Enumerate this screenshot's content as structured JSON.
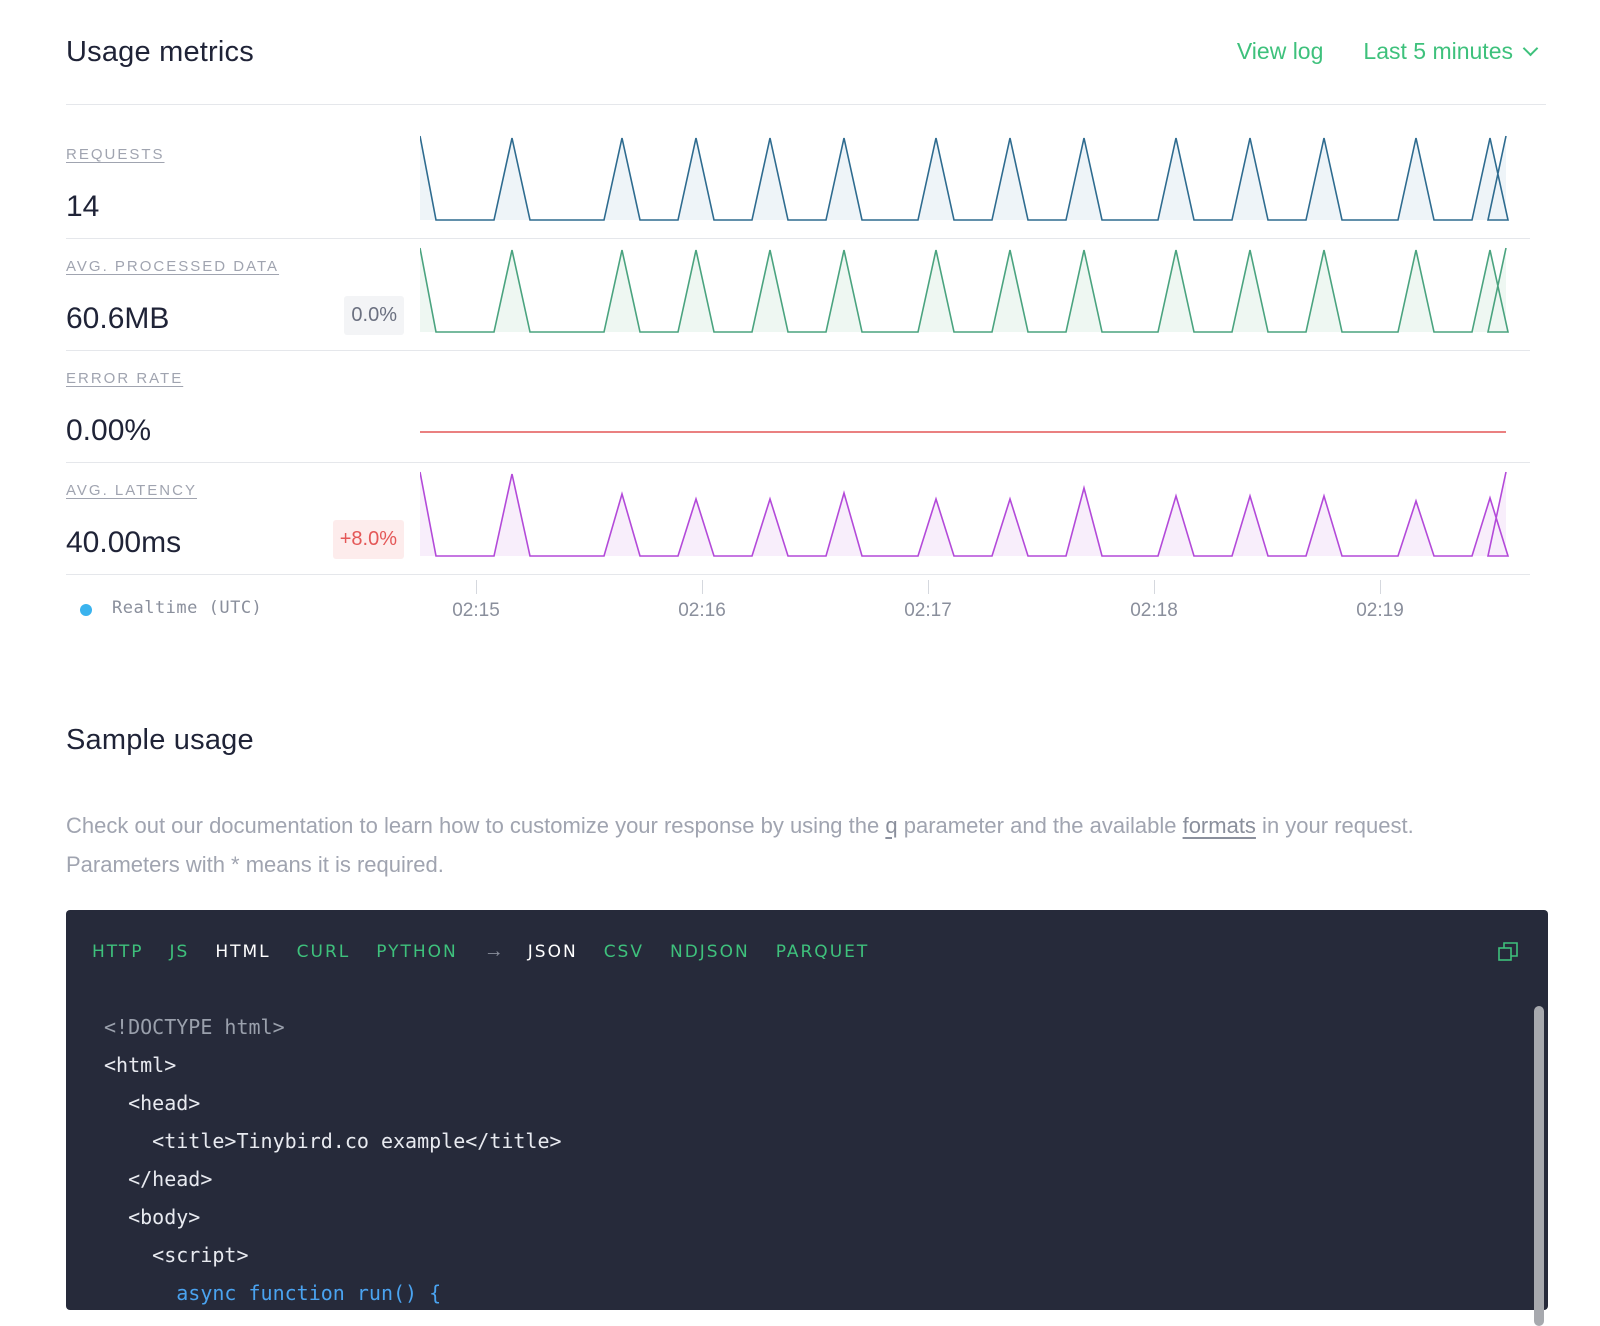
{
  "header": {
    "title": "Usage metrics",
    "view_log": "View log",
    "range": "Last 5 minutes"
  },
  "metrics": [
    {
      "label": "REQUESTS",
      "value": "14",
      "badge": "",
      "color": "#2e6b8f",
      "fill": "#eef4f8"
    },
    {
      "label": "AVG. PROCESSED DATA",
      "value": "60.6MB",
      "badge": "0.0%",
      "color": "#4aa37f",
      "fill": "#eef7f2"
    },
    {
      "label": "ERROR RATE",
      "value": "0.00%",
      "badge": "",
      "color": "#e45757",
      "fill": "none"
    },
    {
      "label": "AVG. LATENCY",
      "value": "40.00ms",
      "badge": "+8.0%",
      "color": "#b34ad9",
      "fill": "#f8eefb"
    }
  ],
  "axis": {
    "legend": "Realtime (UTC)",
    "ticks": [
      "02:15",
      "02:16",
      "02:17",
      "02:18",
      "02:19"
    ]
  },
  "sample": {
    "title": "Sample usage",
    "desc_1": "Check out our documentation to learn how to customize your response by using the ",
    "desc_q": "q",
    "desc_2": " parameter and the available ",
    "desc_formats": "formats",
    "desc_3": " in your request.",
    "desc_4": "Parameters with * means it is required."
  },
  "code_tabs": {
    "languages": [
      "HTTP",
      "JS",
      "HTML",
      "CURL",
      "PYTHON"
    ],
    "active_language": "HTML",
    "arrow": "→",
    "formats": [
      "JSON",
      "CSV",
      "NDJSON",
      "PARQUET"
    ],
    "active_format": "JSON"
  },
  "code_lines": [
    "<!DOCTYPE html>",
    "<html>",
    "  <head>",
    "    <title>Tinybird.co example</title>",
    "  </head>",
    "  <body>",
    "    <script>",
    "      async function run() {"
  ],
  "colors": {
    "accent_green": "#3ec17c",
    "code_bg": "#262a3a",
    "legend_dot": "#3ab3ee"
  },
  "icons": {
    "copy": "copy-icon",
    "range_chevron": "chevron-down-icon",
    "legend": "realtime-dot-icon"
  }
}
